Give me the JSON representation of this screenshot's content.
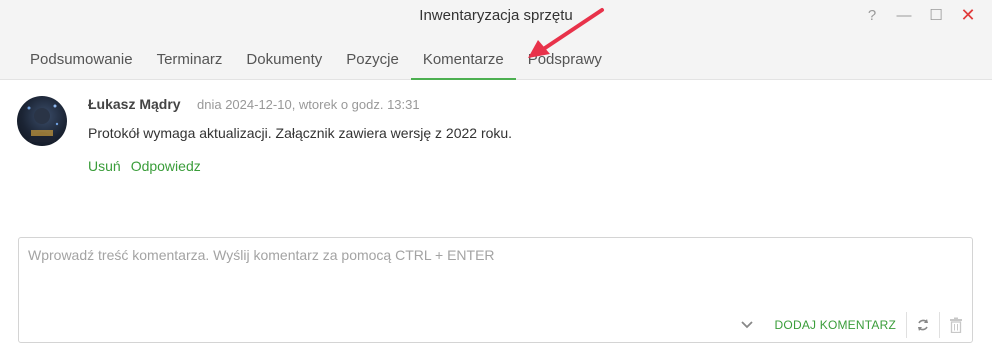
{
  "window": {
    "title": "Inwentaryzacja sprzętu",
    "controls": {
      "help": "?",
      "minimize": "—",
      "maximize": "☐",
      "close": "✕"
    }
  },
  "tabs": [
    {
      "label": "Podsumowanie"
    },
    {
      "label": "Terminarz"
    },
    {
      "label": "Dokumenty"
    },
    {
      "label": "Pozycje"
    },
    {
      "label": "Komentarze",
      "active": true
    },
    {
      "label": "Podsprawy"
    }
  ],
  "comment": {
    "author": "Łukasz Mądry",
    "date": "dnia 2024-12-10, wtorek o godz. 13:31",
    "text": "Protokół wymaga aktualizacji. Załącznik zawiera wersję z 2022 roku.",
    "actions": {
      "delete": "Usuń",
      "reply": "Odpowiedz"
    }
  },
  "composer": {
    "placeholder": "Wprowadź treść komentarza. Wyślij komentarz za pomocą CTRL + ENTER",
    "value": "",
    "submit_label": "DODAJ KOMENTARZ"
  },
  "colors": {
    "accent": "#4caf50",
    "link": "#3a9d3a",
    "close": "#e03a3a",
    "annotation_arrow": "#e8324a"
  }
}
